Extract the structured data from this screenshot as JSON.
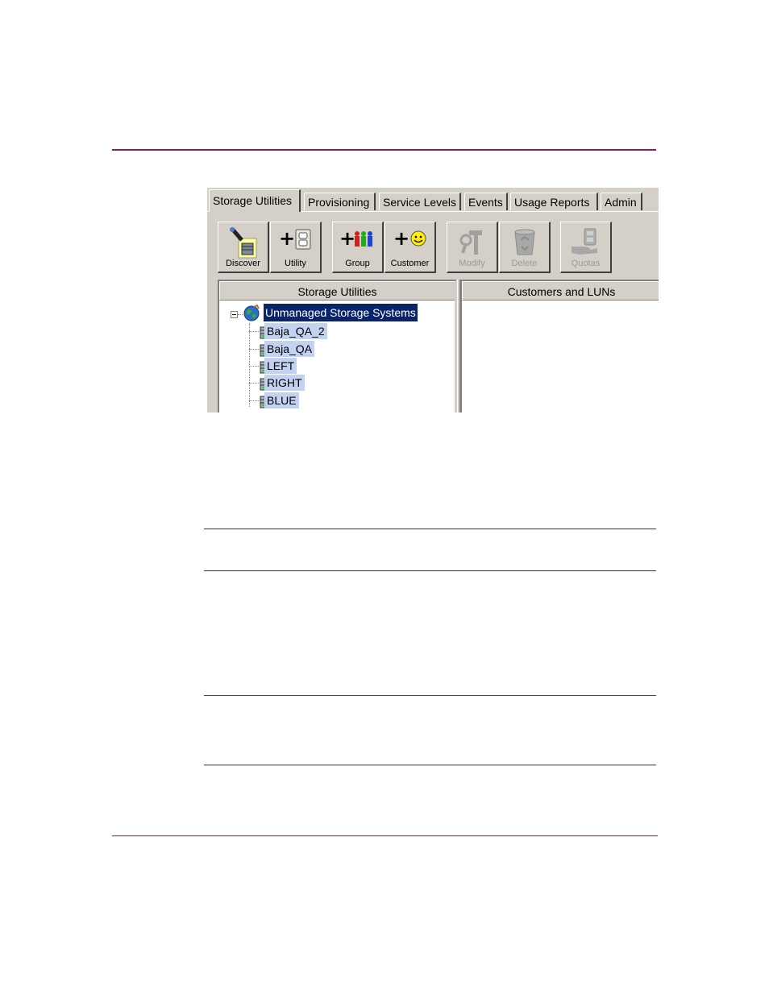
{
  "tabs": [
    {
      "label": "Storage Utilities",
      "active": true
    },
    {
      "label": "Provisioning"
    },
    {
      "label": "Service Levels"
    },
    {
      "label": "Events"
    },
    {
      "label": "Usage Reports"
    },
    {
      "label": "Admin"
    }
  ],
  "toolbar": {
    "discover": {
      "label": "Discover",
      "icon": "flashlight-server-icon"
    },
    "utility": {
      "label": "Utility",
      "icon": "add-outlet-icon"
    },
    "group": {
      "label": "Group",
      "icon": "add-group-icon"
    },
    "customer": {
      "label": "Customer",
      "icon": "add-smiley-icon"
    },
    "modify": {
      "label": "Modify",
      "icon": "tools-icon",
      "enabled": false
    },
    "delete": {
      "label": "Delete",
      "icon": "recycle-bin-icon",
      "enabled": false
    },
    "quotas": {
      "label": "Quotas",
      "icon": "hand-outlet-icon",
      "enabled": false
    }
  },
  "left_pane": {
    "header": "Storage Utilities",
    "tree": {
      "root": "Unmanaged Storage Systems",
      "children": [
        "Baja_QA_2",
        "Baja_QA",
        "LEFT",
        "RIGHT",
        "BLUE"
      ]
    }
  },
  "right_pane": {
    "header": "Customers and LUNs"
  },
  "colors": {
    "rule": "#8b1a6b",
    "selection": "#0a246a",
    "item_highlight": "#c3d2f1",
    "window_bg": "#d4d0c8"
  }
}
